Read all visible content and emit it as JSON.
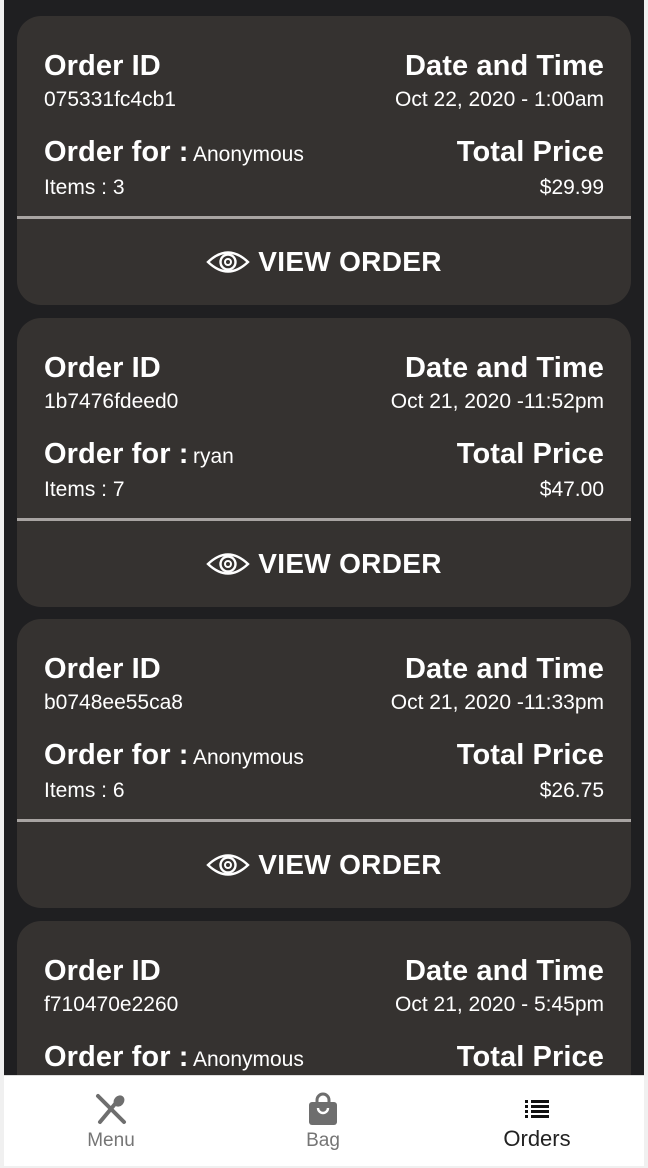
{
  "labels": {
    "order_id": "Order ID",
    "date_time": "Date and Time",
    "order_for": "Order for :",
    "total_price": "Total Price",
    "view_order": "VIEW ORDER"
  },
  "orders": [
    {
      "id": "075331fc4cb1",
      "datetime": "Oct 22, 2020 - 1:00am",
      "customer": "Anonymous",
      "items": "Items : 3",
      "price": "$29.99"
    },
    {
      "id": "1b7476fdeed0",
      "datetime": "Oct 21, 2020 -11:52pm",
      "customer": "ryan",
      "items": "Items : 7",
      "price": "$47.00"
    },
    {
      "id": "b0748ee55ca8",
      "datetime": "Oct 21, 2020 -11:33pm",
      "customer": "Anonymous",
      "items": "Items : 6",
      "price": "$26.75"
    },
    {
      "id": "f710470e2260",
      "datetime": "Oct 21, 2020 - 5:45pm",
      "customer": "Anonymous",
      "items": "",
      "price": ""
    }
  ],
  "nav": {
    "items": [
      {
        "label": "Menu",
        "icon": "fork-knife-icon"
      },
      {
        "label": "Bag",
        "icon": "shopping-bag-icon"
      },
      {
        "label": "Orders",
        "icon": "list-icon"
      }
    ],
    "active": "Orders"
  },
  "colors": {
    "background": "#1f1f21",
    "card": "#353230",
    "divider": "#a8a4a2",
    "nav_background": "#ffffff"
  }
}
